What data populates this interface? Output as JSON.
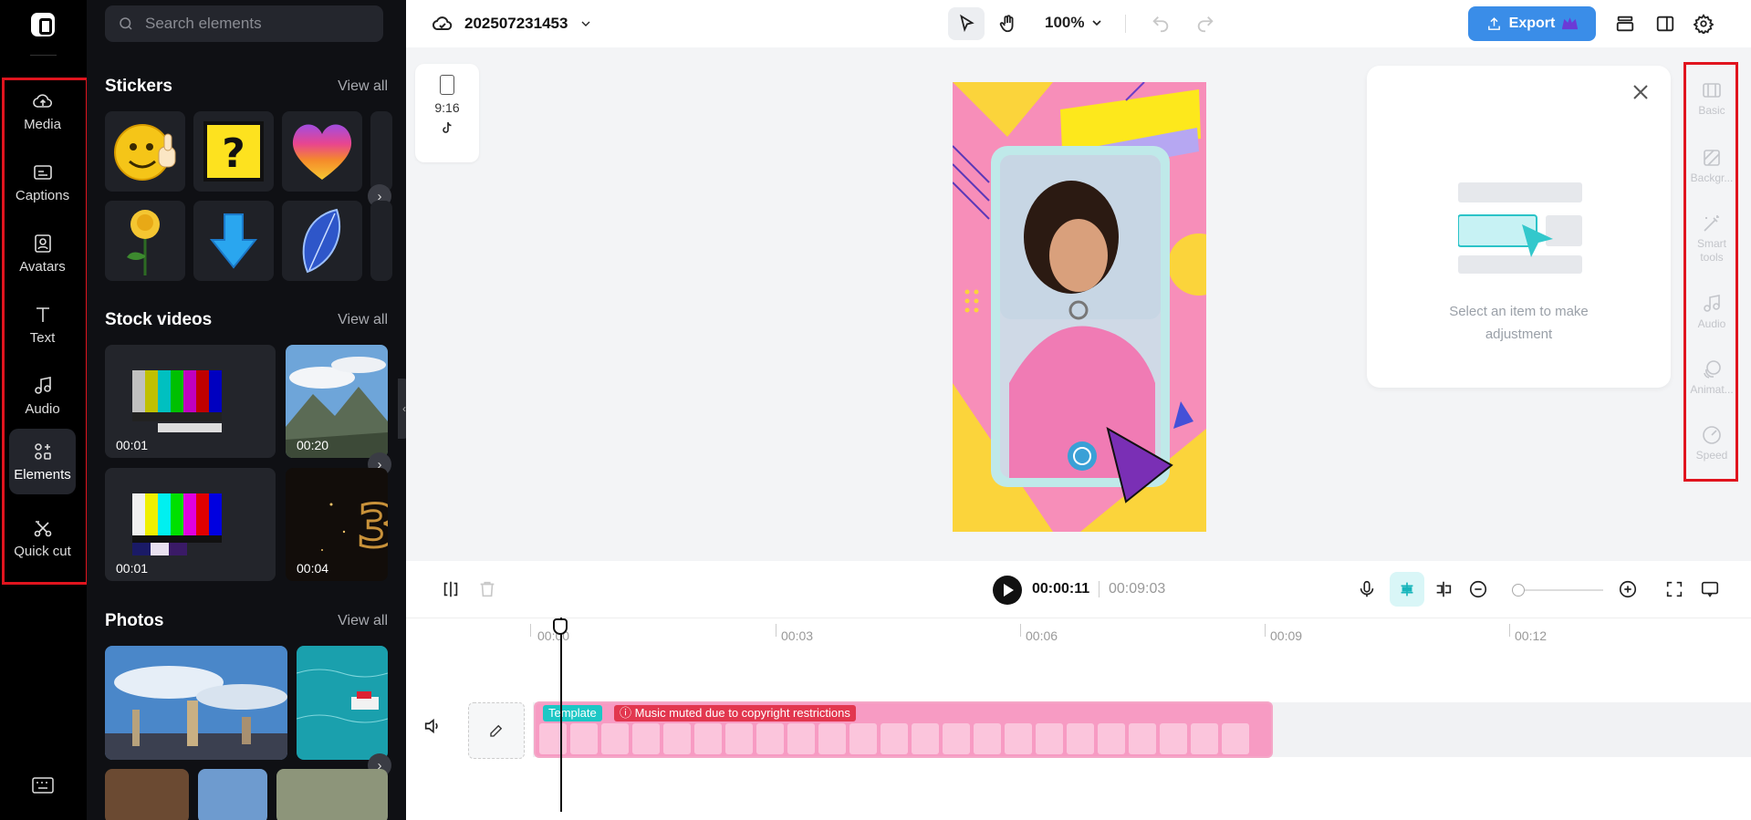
{
  "rail": {
    "items": [
      {
        "label": "Media",
        "icon": "cloud-upload-icon"
      },
      {
        "label": "Captions",
        "icon": "captions-icon"
      },
      {
        "label": "Avatars",
        "icon": "avatar-icon"
      },
      {
        "label": "Text",
        "icon": "text-icon"
      },
      {
        "label": "Audio",
        "icon": "music-note-icon"
      },
      {
        "label": "Elements",
        "icon": "elements-icon",
        "active": true
      },
      {
        "label": "Quick cut",
        "icon": "scissors-icon"
      }
    ]
  },
  "panel": {
    "search_placeholder": "Search elements",
    "stickers": {
      "title": "Stickers",
      "view_all": "View all"
    },
    "stock_videos": {
      "title": "Stock videos",
      "view_all": "View all",
      "items": [
        {
          "duration": "00:01"
        },
        {
          "duration": "00:20"
        },
        {
          "duration": "00:01"
        },
        {
          "duration": "00:04"
        }
      ]
    },
    "photos": {
      "title": "Photos",
      "view_all": "View all"
    }
  },
  "topbar": {
    "project_name": "202507231453",
    "zoom": "100%",
    "export_label": "Export"
  },
  "canvas": {
    "ratio": "9:16",
    "adjust_hint_line1": "Select an item to make",
    "adjust_hint_line2": "adjustment"
  },
  "properties": {
    "items": [
      {
        "label": "Basic",
        "icon": "basic-icon"
      },
      {
        "label": "Backgr...",
        "icon": "background-icon"
      },
      {
        "label": "Smart tools",
        "icon": "magic-wand-icon"
      },
      {
        "label": "Audio",
        "icon": "music-note-icon"
      },
      {
        "label": "Animat...",
        "icon": "animation-icon"
      },
      {
        "label": "Speed",
        "icon": "speed-icon"
      }
    ]
  },
  "timeline": {
    "current_time": "00:00:11",
    "total_time": "00:09:03",
    "ruler": [
      "00:00",
      "00:03",
      "00:06",
      "00:09",
      "00:12"
    ],
    "clip_tag": "Template",
    "clip_warning": "Music muted due to copyright restrictions"
  },
  "colors": {
    "accent": "#3a8de8",
    "highlight": "#e0141e",
    "clip": "#f79bc3",
    "template_tag": "#1cc7c5",
    "warning_tag": "#e2374f"
  }
}
